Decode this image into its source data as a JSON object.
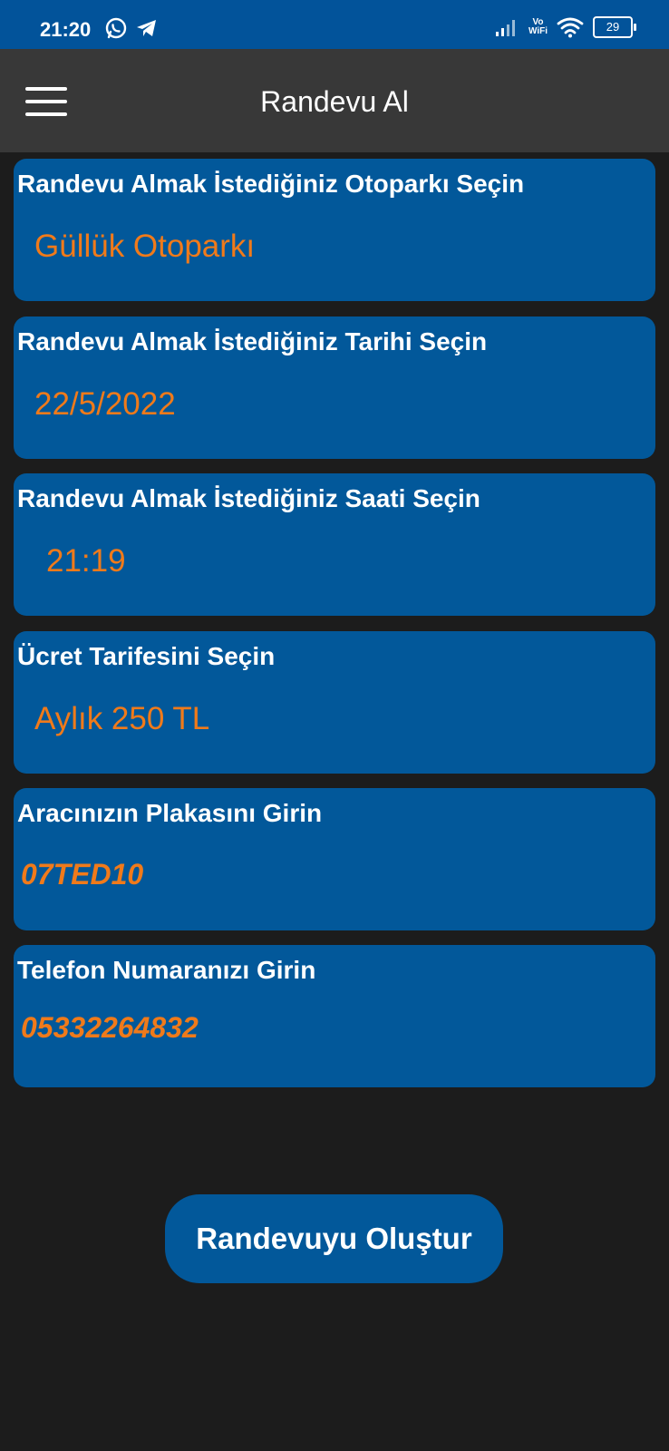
{
  "status_bar": {
    "time": "21:20",
    "battery": "29",
    "volte_top": "Vo",
    "volte_bottom": "WiFi"
  },
  "app_bar": {
    "title": "Randevu Al"
  },
  "cards": {
    "parking": {
      "label": "Randevu Almak İstediğiniz Otoparkı Seçin",
      "value": "Güllük Otoparkı"
    },
    "date": {
      "label": "Randevu Almak İstediğiniz Tarihi Seçin",
      "value": "22/5/2022"
    },
    "time": {
      "label": "Randevu Almak İstediğiniz Saati Seçin",
      "value": "21:19"
    },
    "tariff": {
      "label": "Ücret Tarifesini Seçin",
      "value": "Aylık 250 TL"
    },
    "plate": {
      "label": "Aracınızın Plakasını Girin",
      "value": "07TED10"
    },
    "phone": {
      "label": "Telefon Numaranızı Girin",
      "value": "05332264832"
    }
  },
  "submit": {
    "label": "Randevuyu Oluştur"
  },
  "colors": {
    "accent": "#02589a",
    "value_text": "#f07a1a",
    "background": "#1c1c1c",
    "app_bar": "#383838"
  }
}
